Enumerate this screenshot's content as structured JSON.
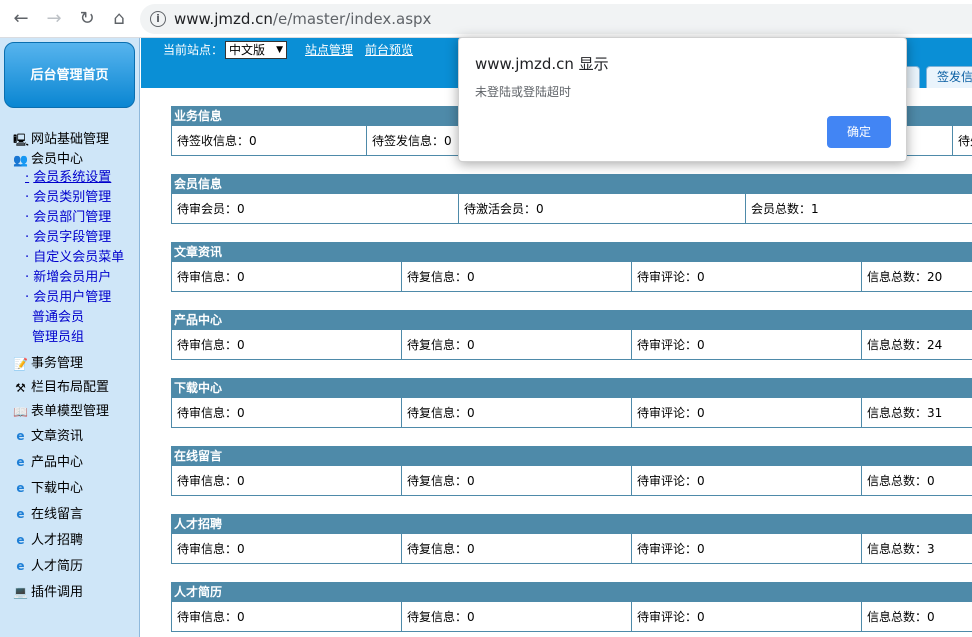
{
  "browser": {
    "back_icon": "←",
    "forward_icon": "→",
    "reload_icon": "↻",
    "home_icon": "⌂",
    "info_icon": "i",
    "url_host": "www.jmzd.cn",
    "url_path": "/e/master/index.aspx"
  },
  "sidebar": {
    "home_button": "后台管理首页",
    "items": [
      {
        "label": "网站基础管理",
        "icon": "🖳"
      },
      {
        "label": "会员中心",
        "icon": "👥"
      }
    ],
    "member_sub": [
      "会员系统设置",
      "会员类别管理",
      "会员部门管理",
      "会员字段管理",
      "自定义会员菜单",
      "新增会员用户",
      "会员用户管理"
    ],
    "member_sub2": [
      "普通会员",
      "管理员组"
    ],
    "items2": [
      {
        "label": "事务管理",
        "icon": "📝"
      },
      {
        "label": "栏目布局配置",
        "icon": "⚒"
      },
      {
        "label": "表单模型管理",
        "icon": "📖"
      },
      {
        "label": "文章资讯",
        "icon": "e"
      },
      {
        "label": "产品中心",
        "icon": "e"
      },
      {
        "label": "下载中心",
        "icon": "e"
      },
      {
        "label": "在线留言",
        "icon": "e"
      },
      {
        "label": "人才招聘",
        "icon": "e"
      },
      {
        "label": "人才简历",
        "icon": "e"
      },
      {
        "label": "插件调用",
        "icon": "💻"
      }
    ],
    "sub_bullet": "·"
  },
  "topbar": {
    "site_label": "当前站点：",
    "site_select": "中文版",
    "site_select_arrow": "▼",
    "site_manage": "站点管理",
    "front_preview": "前台预览",
    "tab_partial": "签发信"
  },
  "content": {
    "business": {
      "title": "业务信息",
      "cells": [
        "待签收信息：0",
        "待签发信息：0",
        "待处"
      ]
    },
    "member": {
      "title": "会员信息",
      "cells": [
        "待审会员：0",
        "待激活会员：0",
        "会员总数：1"
      ]
    },
    "sections": [
      {
        "title": "文章资讯",
        "cells": [
          "待审信息：0",
          "待复信息：0",
          "待审评论：0",
          "信息总数：20"
        ]
      },
      {
        "title": "产品中心",
        "cells": [
          "待审信息：0",
          "待复信息：0",
          "待审评论：0",
          "信息总数：24"
        ]
      },
      {
        "title": "下载中心",
        "cells": [
          "待审信息：0",
          "待复信息：0",
          "待审评论：0",
          "信息总数：31"
        ]
      },
      {
        "title": "在线留言",
        "cells": [
          "待审信息：0",
          "待复信息：0",
          "待审评论：0",
          "信息总数：0"
        ]
      },
      {
        "title": "人才招聘",
        "cells": [
          "待审信息：0",
          "待复信息：0",
          "待审评论：0",
          "信息总数：3"
        ]
      },
      {
        "title": "人才简历",
        "cells": [
          "待审信息：0",
          "待复信息：0",
          "待审评论：0",
          "信息总数：0"
        ]
      }
    ]
  },
  "dialog": {
    "title": "www.jmzd.cn 显示",
    "message": "未登陆或登陆超时",
    "ok": "确定"
  }
}
